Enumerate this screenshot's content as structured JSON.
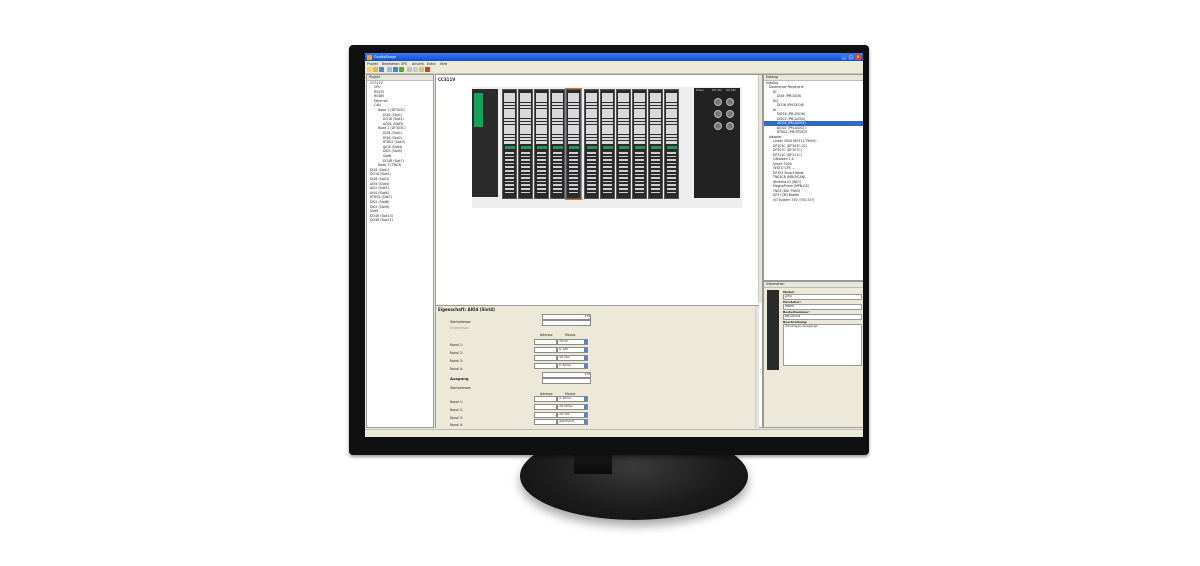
{
  "window": {
    "title": "ConfigStage",
    "min": "_",
    "max": "□",
    "close": "×"
  },
  "menu": [
    "Projekt",
    "Bearbeiten",
    "SPS",
    "Ansicht",
    "Extra",
    "Hilfe"
  ],
  "project": {
    "header": "Projekt",
    "tree": [
      "CC311V",
      "CPU",
      "RS232",
      "RS485",
      "Ethernet",
      "CAN",
      "Node 1 (DF303C)",
      "DI16 (Slot1)",
      "DO16 (Slot2)",
      "AO04 (Slot3)",
      "Node 2 (DF303C)",
      "DI16 (Slot1)",
      "DI16 (Slot2)",
      "RTD02 (Slot3)",
      "AIO4 (Slot4)",
      "DI02 (Slot5)",
      "Slot6",
      "DO4R (Slot7)",
      "Node 3 (TN03)",
      "DI16 (Slot1)",
      "DO16 (Slot2)",
      "DI16 (Slot3)",
      "AIO4 (Slot4)",
      "AI02 (Slot5)",
      "AI04 (Slot6)",
      "RTD02 (Slot7)",
      "DI02 (Slot8)",
      "DI02 (Slot9)",
      "Slot9",
      "DO4R (Slot10)",
      "DO4R (Slot11)"
    ]
  },
  "rack": {
    "title": "CC311V",
    "power_labels": [
      "Power",
      "DO 24V",
      "DO 24V"
    ]
  },
  "properties": {
    "title": "Eigenschaft: AIO4 (Slot4)",
    "start_address_label": "Startadresse:",
    "start_value": "176",
    "end_address_label": "Endadresse:",
    "col_address": "Adresse",
    "col_mode": "Modus",
    "channels_in": [
      {
        "label": "Kanal 1:",
        "mode": "±0-5V"
      },
      {
        "label": "Kanal 2:",
        "mode": "0..10V"
      },
      {
        "label": "Kanal 3:",
        "mode": "±0-10V"
      },
      {
        "label": "Kanal 4:",
        "mode": "0..20mA"
      }
    ],
    "output_title": "Ausgang",
    "output_start": "176",
    "channels_out": [
      {
        "label": "Kanal 1:",
        "mode": "4..20mA"
      },
      {
        "label": "Kanal 2:",
        "mode": "±0-20mA"
      },
      {
        "label": "Kanal 3:",
        "mode": "±0-10V"
      },
      {
        "label": "Kanal 4:",
        "mode": "deaktiviert"
      }
    ]
  },
  "catalog": {
    "header": "Katalog",
    "items": [
      "Katalog",
      "Dezentrale Peripherie",
      "DI",
      "DI16 (PM-DI16)",
      "DO",
      "DO16 (PM-DO16)",
      "AI",
      "DI016 (PM-DI016)",
      "DI202 (PM-DI202)",
      "AIO04 (PM-AIO04)",
      "AIO02 (PM-AIO02)",
      "RTD02 (PM-RTD02)",
      "Adapter",
      "Linear 3000 (BF311-T9000)",
      "DF303C (DF303C-02)",
      "DF307C (DF307C)",
      "DF311C (DF311C)",
      "CANopen 1.0",
      "Smart 3000",
      "FESTO CPX ...",
      "DF393 Smart-Node",
      "TN03CB (MDI3/CAN)",
      "Wireless IO (WIO)",
      "MagnaPrime (MPN-DC)",
      "TN03 (DN: TN03)",
      "DF3 (CM) Mobile",
      "I/O System 750 (750-337)"
    ]
  },
  "info": {
    "header": "Information",
    "typ_label": "Modul:",
    "typ_value": "AIO4",
    "hersteller_label": "Hersteller:",
    "hersteller_value": "INDRO",
    "bestell_label": "Bestellnummer:",
    "bestell_value": "PM-AIO4V2",
    "beschr_label": "Beschreibung:",
    "beschr_value": "4 Analogein-/ausgänge"
  },
  "colors": {
    "titlebar": "#0a4fd8",
    "module_led": "#1f9a5a",
    "selected_module": "#e07020"
  }
}
